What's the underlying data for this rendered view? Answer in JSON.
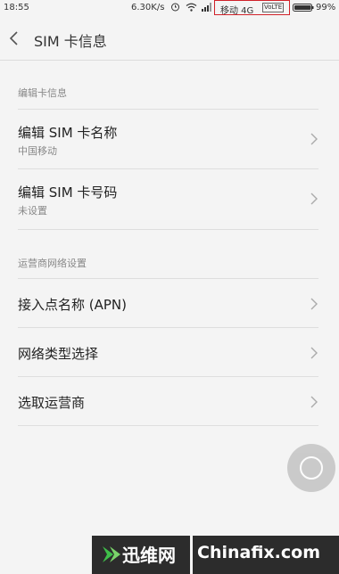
{
  "status_bar": {
    "time": "18:55",
    "speed": "6.30K/s",
    "carrier": "移动 4G",
    "volte": "VoLTE",
    "battery": "99%",
    "highlight_color": "#d0222a"
  },
  "header": {
    "title": "SIM 卡信息"
  },
  "sections": [
    {
      "title": "编辑卡信息",
      "items": [
        {
          "label": "编辑 SIM 卡名称",
          "value": "中国移动"
        },
        {
          "label": "编辑 SIM 卡号码",
          "value": "未设置"
        }
      ]
    },
    {
      "title": "运营商网络设置",
      "items": [
        {
          "label": "接入点名称 (APN)"
        },
        {
          "label": "网络类型选择"
        },
        {
          "label": "选取运营商"
        }
      ]
    }
  ],
  "watermark": {
    "cn": "迅维网",
    "en": "Chinafix.com",
    "accent": "#3fbf4a"
  }
}
